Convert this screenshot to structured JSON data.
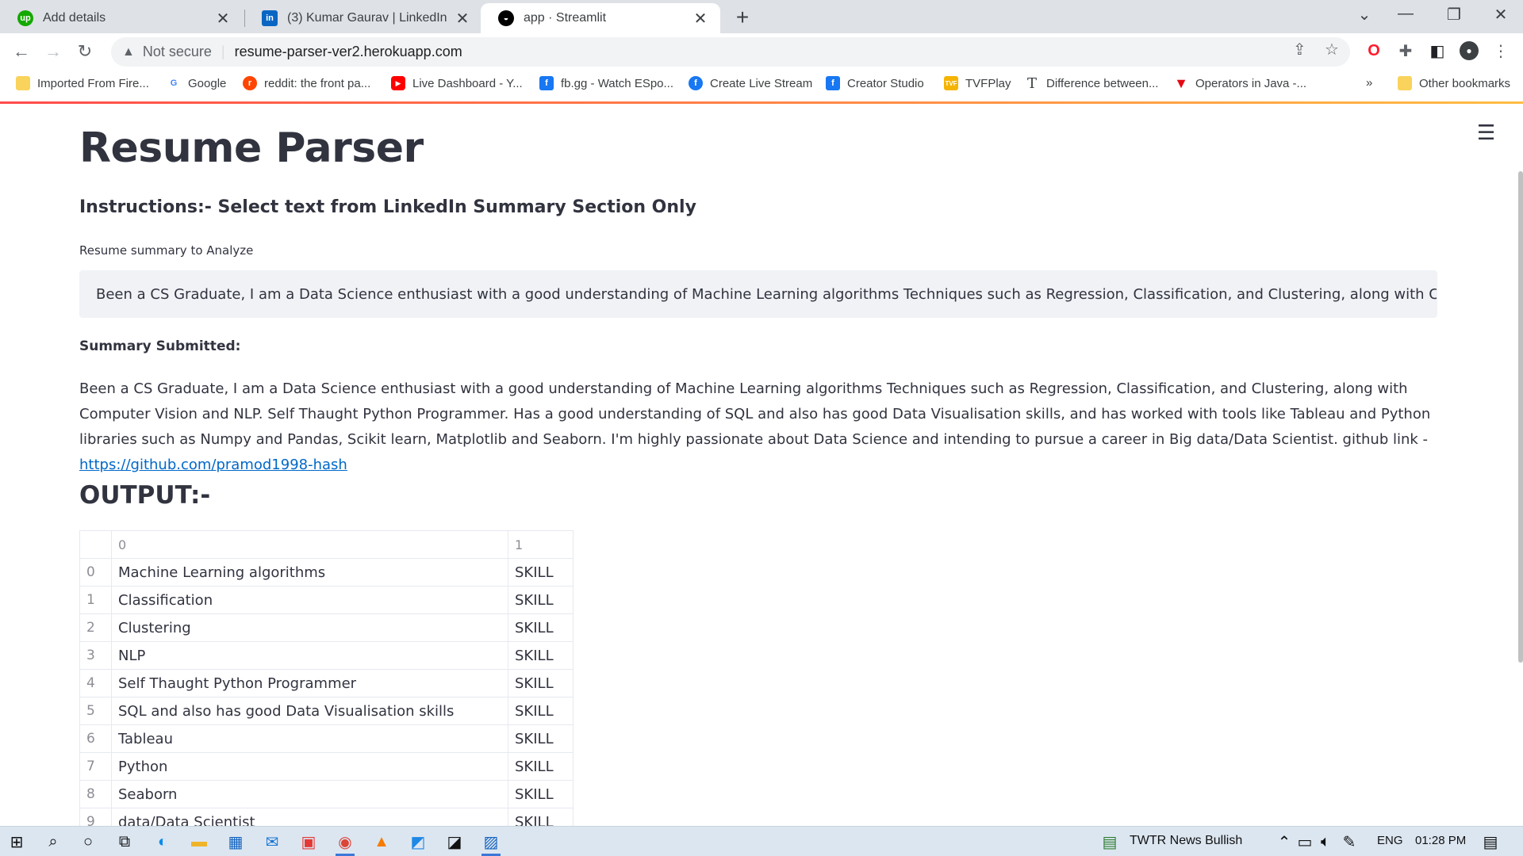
{
  "browser": {
    "tabs": [
      {
        "title": "Add details",
        "favicon": "upwork-icon",
        "active": false
      },
      {
        "title": "(3) Kumar Gaurav | LinkedIn",
        "favicon": "linkedin-icon",
        "active": false
      },
      {
        "title": "app · Streamlit",
        "favicon": "streamlit-icon",
        "active": true
      }
    ],
    "address": {
      "security": "Not secure",
      "url": "resume-parser-ver2.herokuapp.com"
    },
    "bookmarks": [
      "Imported From Fire...",
      "Google",
      "reddit: the front pa...",
      "Live Dashboard - Y...",
      "fb.gg - Watch ESpo...",
      "Create Live Stream",
      "Creator Studio",
      "TVFPlay",
      "Difference between...",
      "Operators in Java -..."
    ],
    "other_bookmarks": "Other bookmarks",
    "more_bookmarks": "»"
  },
  "app": {
    "title": "Resume Parser",
    "instructions": "Instructions:- Select text from LinkedIn Summary Section Only",
    "input_label": "Resume summary to Analyze",
    "input_value": "Been a CS Graduate, I am a Data Science enthusiast with a good understanding of Machine Learning algorithms Techniques such as Regression, Classification, and Clustering, along with Computer Vision",
    "submitted_label": "Summary Submitted:",
    "submitted_text": "Been a CS Graduate, I am a Data Science enthusiast with a good understanding of Machine Learning algorithms Techniques such as Regression, Classification, and Clustering, along with Computer Vision and NLP. Self Thaught Python Programmer. Has a good understanding of SQL and also has good Data Visualisation skills, and has worked with tools like Tableau and Python libraries such as Numpy and Pandas, Scikit learn, Matplotlib and Seaborn. I'm highly passionate about Data Science and intending to pursue a career in Big data/Data Scientist. github link - ",
    "github_link": "https://github.com/pramod1998-hash",
    "output_title": "OUTPUT:-",
    "table": {
      "headers": [
        "0",
        "1"
      ],
      "rows": [
        {
          "index": "0",
          "entity": "Machine Learning algorithms",
          "label": "SKILL"
        },
        {
          "index": "1",
          "entity": "Classification",
          "label": "SKILL"
        },
        {
          "index": "2",
          "entity": "Clustering",
          "label": "SKILL"
        },
        {
          "index": "3",
          "entity": "NLP",
          "label": "SKILL"
        },
        {
          "index": "4",
          "entity": "Self Thaught Python Programmer",
          "label": "SKILL"
        },
        {
          "index": "5",
          "entity": "SQL and also has good Data Visualisation skills",
          "label": "SKILL"
        },
        {
          "index": "6",
          "entity": "Tableau",
          "label": "SKILL"
        },
        {
          "index": "7",
          "entity": "Python",
          "label": "SKILL"
        },
        {
          "index": "8",
          "entity": "Seaborn",
          "label": "SKILL"
        },
        {
          "index": "9",
          "entity": "data/Data Scientist",
          "label": "SKILL"
        }
      ]
    }
  },
  "taskbar": {
    "news": "TWTR  News Bullish",
    "language": "ENG",
    "time": "01:28 PM"
  },
  "colors": {
    "accent_link": "#0068c9",
    "streamlit_red": "#ff4b4b",
    "input_bg": "#f0f2f6"
  }
}
